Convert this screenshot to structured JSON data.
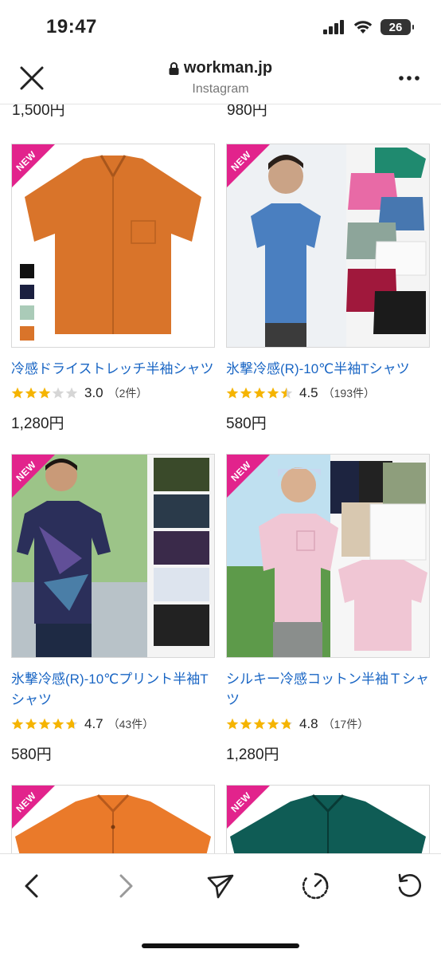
{
  "status_bar": {
    "time": "19:47",
    "battery": "26"
  },
  "browser": {
    "url": "workman.jp",
    "source": "Instagram"
  },
  "top_prices": [
    "1,500円",
    "980円"
  ],
  "new_label": "NEW",
  "products": [
    {
      "title": "冷感ドライストレッチ半袖シャツ",
      "rating": 3.0,
      "score": "3.0",
      "count": "（2件）",
      "price": "1,280円",
      "shirt_color": "#d9742a",
      "bg": "#ffffff"
    },
    {
      "title": "氷撃冷感(R)-10℃半袖Tシャツ",
      "rating": 4.5,
      "score": "4.5",
      "count": "（193件）",
      "price": "580円",
      "shirt_color": "#4a7fc0",
      "bg": "#eef1f4"
    },
    {
      "title": "氷撃冷感(R)-10℃プリント半袖Tシャツ",
      "rating": 4.7,
      "score": "4.7",
      "count": "（43件）",
      "price": "580円",
      "shirt_color": "#2b2f5a",
      "bg": "#a8c98d"
    },
    {
      "title": "シルキー冷感コットン半袖Ｔシャツ",
      "rating": 4.8,
      "score": "4.8",
      "count": "（17件）",
      "price": "1,280円",
      "shirt_color": "#f0c6d4",
      "bg": "#bfe0f0"
    },
    {
      "title": "",
      "shirt_color": "#ea7a2a",
      "bg": "#ffffff"
    },
    {
      "title": "",
      "shirt_color": "#0f5c55",
      "bg": "#ffffff"
    }
  ],
  "colors": {
    "link": "#1a66c4",
    "star": "#f5b400",
    "star_empty": "#d6d6d6",
    "new_tag": "#e2238c"
  },
  "icons": [
    "close-icon",
    "lock-icon",
    "more-icon",
    "back-icon",
    "forward-icon",
    "share-icon",
    "speed-icon",
    "reload-icon"
  ]
}
